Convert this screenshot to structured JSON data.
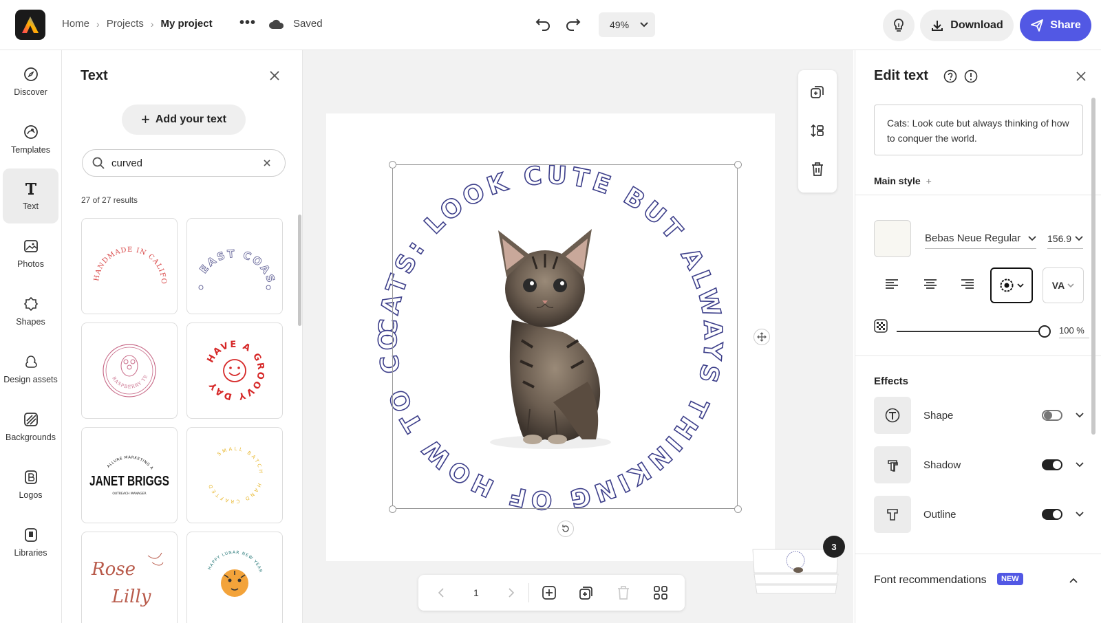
{
  "topbar": {
    "breadcrumbs": [
      "Home",
      "Projects",
      "My project"
    ],
    "save_status": "Saved",
    "zoom": "49%",
    "download_label": "Download",
    "share_label": "Share",
    "accent_color": "#5258e4"
  },
  "rail": {
    "items": [
      {
        "label": "Discover",
        "icon": "compass-icon"
      },
      {
        "label": "Templates",
        "icon": "templates-icon"
      },
      {
        "label": "Text",
        "icon": "text-icon",
        "active": true
      },
      {
        "label": "Photos",
        "icon": "photo-icon"
      },
      {
        "label": "Shapes",
        "icon": "shapes-icon"
      },
      {
        "label": "Design assets",
        "icon": "design-assets-icon"
      },
      {
        "label": "Backgrounds",
        "icon": "backgrounds-icon"
      },
      {
        "label": "Logos",
        "icon": "logos-icon"
      },
      {
        "label": "Libraries",
        "icon": "libraries-icon"
      }
    ]
  },
  "text_panel": {
    "title": "Text",
    "add_text_label": "Add your text",
    "search_value": "curved",
    "results_count": "27 of 27 results",
    "tiles": [
      {
        "name": "handmade-in-california",
        "text": "HANDMADE IN CALIFORNIA",
        "color": "#d94a4a"
      },
      {
        "name": "east-coast",
        "text": "EAST COAST",
        "color": "#6a6a9c"
      },
      {
        "name": "raspberry-tea",
        "text": "RASPBERRY TEA",
        "color": "#c86a88"
      },
      {
        "name": "have-a-groovy-day",
        "text": "HAVE A GROOVY DAY",
        "color": "#d62828"
      },
      {
        "name": "janet-briggs",
        "text": "JANET BRIGGS",
        "subtext": "ALLURE MARKETING AGENCY",
        "subtext2": "OUTREACH MANAGER",
        "color": "#111111"
      },
      {
        "name": "small-batch",
        "text": "SMALL BATCH",
        "subtext": "HAND CRAFTED",
        "color": "#e8b830"
      },
      {
        "name": "rose-lilly",
        "text": "Rose",
        "subtext": "Lilly",
        "color": "#b85a4a"
      },
      {
        "name": "happy-lunar-new-year",
        "text": "HAPPY LUNAR NEW YEAR",
        "color": "#2a7a7a"
      }
    ]
  },
  "canvas": {
    "curved_text": "CATS: LOOK CUTE BUT ALWAYS THINKING OF HOW TO CONQUER THE WORLD.",
    "text_color": "#3d3f8a",
    "page_number": "1",
    "page_count": "3"
  },
  "edit_panel": {
    "title": "Edit text",
    "text_value": "Cats: Look cute but always thinking of how to conquer the world.",
    "main_style_label": "Main style",
    "font_name": "Bebas Neue Regular",
    "font_size": "156.9",
    "spacing_label": "VA",
    "opacity_value": "100 %",
    "opacity_level": 1.0,
    "effects_label": "Effects",
    "effects": [
      {
        "label": "Shape",
        "on": false,
        "icon": "shape-effect-icon"
      },
      {
        "label": "Shadow",
        "on": true,
        "icon": "shadow-effect-icon"
      },
      {
        "label": "Outline",
        "on": true,
        "icon": "outline-effect-icon"
      }
    ],
    "font_rec_label": "Font recommendations",
    "new_badge": "NEW"
  }
}
